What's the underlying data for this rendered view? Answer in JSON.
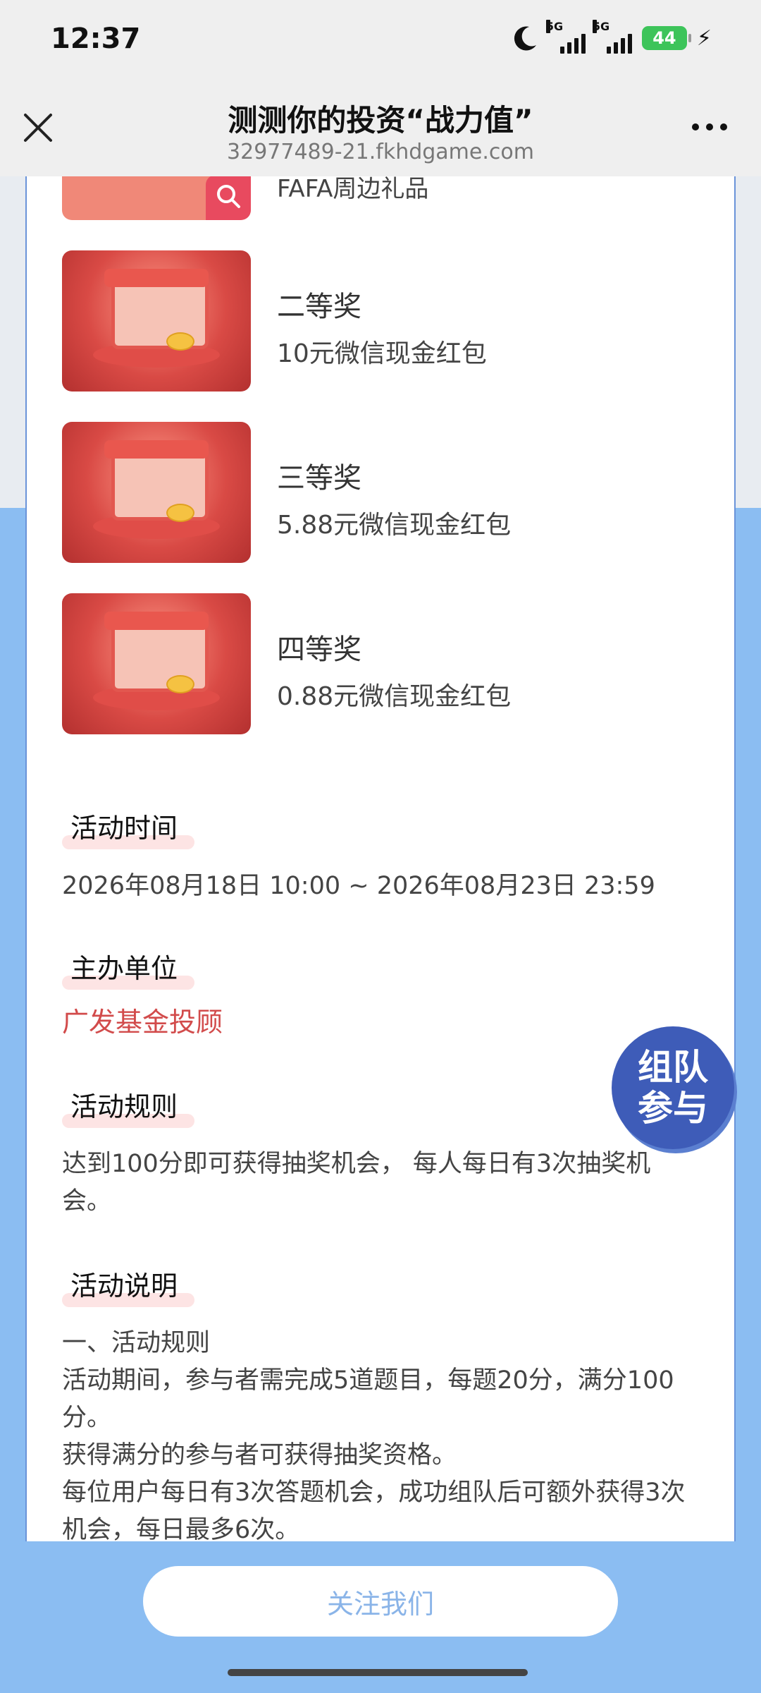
{
  "status_bar": {
    "time": "12:37",
    "network_1": "5G",
    "network_2": "5G",
    "battery": "44"
  },
  "header": {
    "title": "测测你的投资“战力值”",
    "url": "32977489-21.fkhdgame.com"
  },
  "prizes": {
    "partial_text": "FAFA周边礼品",
    "items": [
      {
        "name": "二等奖",
        "desc": "10元微信现金红包"
      },
      {
        "name": "三等奖",
        "desc": "5.88元微信现金红包"
      },
      {
        "name": "四等奖",
        "desc": "0.88元微信现金红包"
      }
    ]
  },
  "sections": {
    "time_title": "活动时间",
    "time_value": "2026年08月18日 10:00 ~ 2026年08月23日 23:59",
    "organizer_title": "主办单位",
    "organizer_value": "广发基金投顾",
    "rules_title": "活动规则",
    "rules_value": "达到100分即可获得抽奖机会， 每人每日有3次抽奖机会。",
    "desc_title": "活动说明",
    "desc_lines": [
      "一、活动规则",
      "活动期间，参与者需完成5道题目，每题20分，满分100分。",
      "获得满分的参与者可获得抽奖资格。",
      "每位用户每日有3次答题机会，成功组队后可额外获得3次机会，每日最多6次。"
    ]
  },
  "buttons": {
    "team_line1": "组队",
    "team_line2": "参与",
    "follow": "关注我们"
  },
  "colors": {
    "page_bg": "#8bbdf2",
    "accent_red": "#d24b4b",
    "team_blue": "#3e5cb8"
  }
}
